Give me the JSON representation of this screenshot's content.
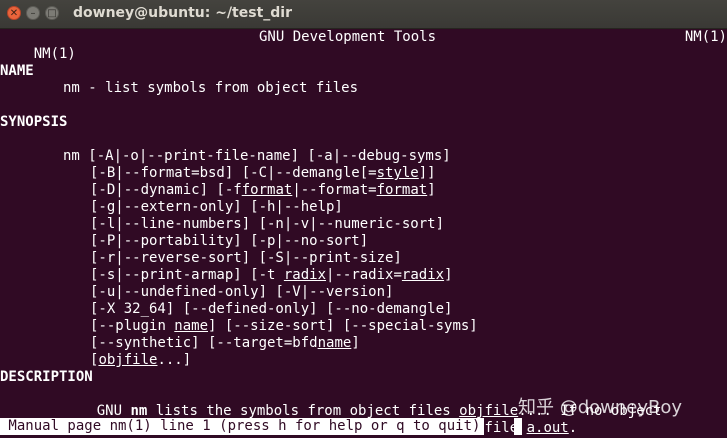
{
  "window": {
    "title": "downey@ubuntu: ~/test_dir",
    "close_glyph": "✕",
    "minimize_glyph": "–",
    "maximize_glyph": "□"
  },
  "man": {
    "header_left": "NM(1)",
    "header_center": "GNU Development Tools",
    "header_right": "NM(1)",
    "name_heading": "NAME",
    "name_text": "nm - list symbols from object files",
    "synopsis_heading": "SYNOPSIS",
    "synopsis_lines": [
      "nm [-A|-o|--print-file-name] [-a|--debug-syms]",
      "[-B|--format=bsd] [-C|--demangle[=style]]",
      "[-D|--dynamic] [-fformat|--format=format]",
      "[-g|--extern-only] [-h|--help]",
      "[-l|--line-numbers] [-n|-v|--numeric-sort]",
      "[-P|--portability] [-p|--no-sort]",
      "[-r|--reverse-sort] [-S|--print-size]",
      "[-s|--print-armap] [-t radix|--radix=radix]",
      "[-u|--undefined-only] [-V|--version]",
      "[-X 32_64] [--defined-only] [--no-demangle]",
      "[--plugin name] [--size-sort] [--special-syms]",
      "[--synthetic] [--target=bfdname]",
      "[objfile...]"
    ],
    "description_heading": "DESCRIPTION",
    "description_lines": [
      "GNU nm lists the symbols from object files objfile.... If no object",
      "files are listed as arguments, nm assumes the file a.out."
    ]
  },
  "status_bar": " Manual page nm(1) line 1 (press h for help or q to quit)",
  "watermark": "知乎 @downeyBoy",
  "colors": {
    "terminal_bg": "#300a24",
    "terminal_fg": "#ffffff",
    "titlebar_bg": "#3c3b37",
    "close_button": "#e9643b"
  }
}
